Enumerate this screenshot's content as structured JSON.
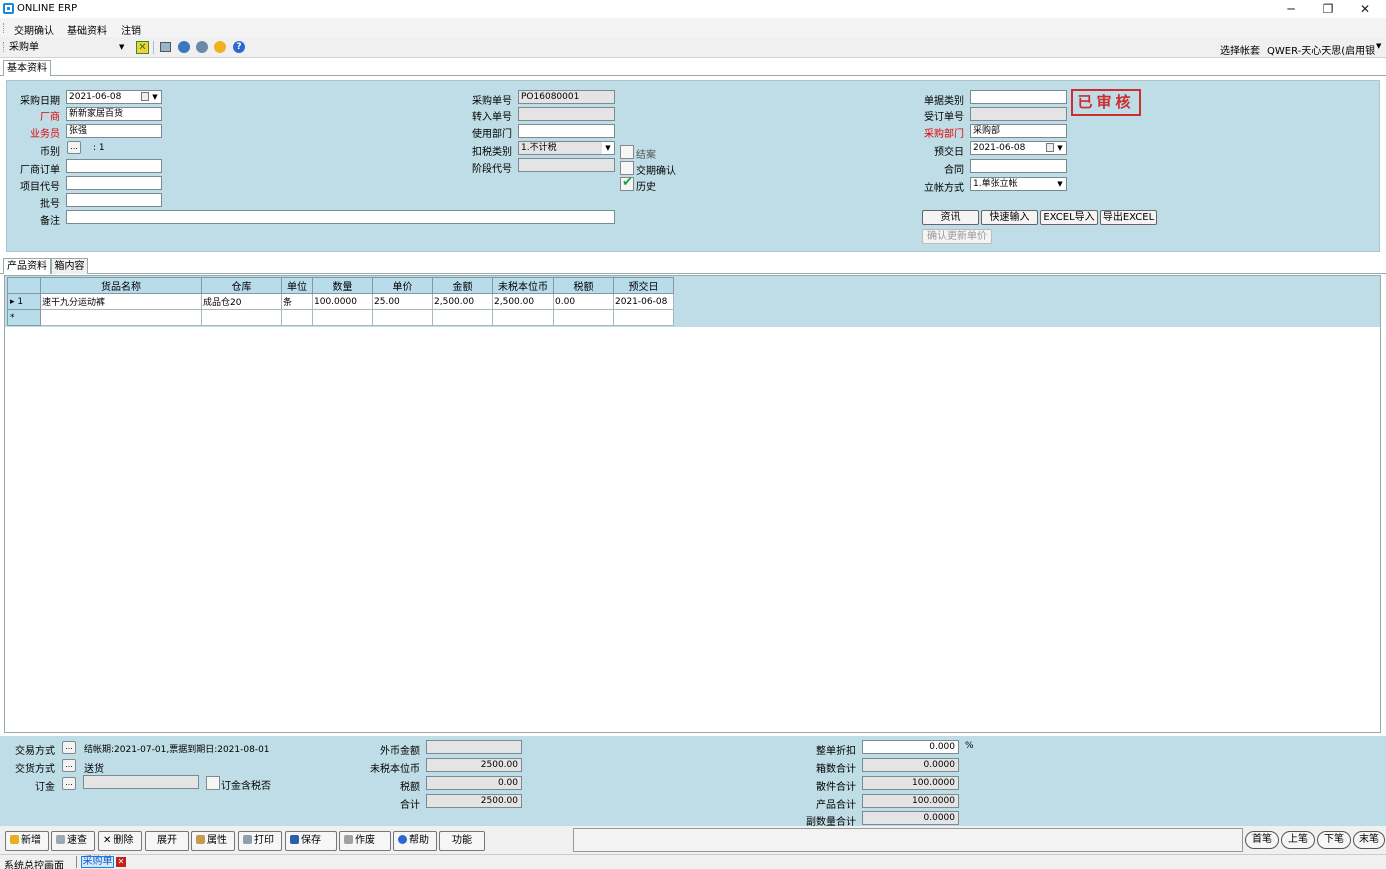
{
  "window": {
    "title": "ONLINE ERP",
    "minimize": "─",
    "restore": "❐",
    "close": "✕"
  },
  "menu": [
    "交期确认",
    "基础资料",
    "注销"
  ],
  "toolbar": {
    "form_select": "采购单",
    "account_label": "选择帐套",
    "account_value": "QWER-天心天思(启用银"
  },
  "main_tab": "基本资料",
  "header": {
    "purchase_date": {
      "label": "采购日期",
      "value": "2021-06-08"
    },
    "vendor": {
      "label": "厂商",
      "value": "新新家居百货"
    },
    "salesperson": {
      "label": "业务员",
      "value": "张强"
    },
    "currency": {
      "label": "币别",
      "btn": "...",
      "rate": ": 1"
    },
    "vendor_order": {
      "label": "厂商订单",
      "value": ""
    },
    "project_code": {
      "label": "项目代号",
      "value": ""
    },
    "batch_no": {
      "label": "批号",
      "value": ""
    },
    "remark": {
      "label": "备注",
      "value": ""
    },
    "purchase_no": {
      "label": "采购单号",
      "value": "PO16080001"
    },
    "import_no": {
      "label": "转入单号",
      "value": ""
    },
    "use_dept": {
      "label": "使用部门",
      "value": ""
    },
    "tax_type": {
      "label": "扣税类别",
      "value": "1.不计税"
    },
    "stage_code": {
      "label": "阶段代号",
      "value": ""
    },
    "chk_closed": {
      "label": "结案",
      "checked": false
    },
    "chk_delivery": {
      "label": "交期确认",
      "checked": false
    },
    "chk_history": {
      "label": "历史",
      "checked": true
    },
    "doc_category": {
      "label": "单据类别",
      "value": ""
    },
    "order_no": {
      "label": "受订单号",
      "value": ""
    },
    "purchase_dept": {
      "label": "采购部门",
      "value": "采购部"
    },
    "delivery_date": {
      "label": "预交日",
      "value": "2021-06-08"
    },
    "contract": {
      "label": "合同",
      "value": ""
    },
    "account_method": {
      "label": "立帐方式",
      "value": "1.单张立帐"
    },
    "stamp": "已审核",
    "buttons": {
      "info": "资讯",
      "quick_input": "快速输入",
      "excel_import": "EXCEL导入",
      "excel_export": "导出EXCEL",
      "confirm_price": "确认更新单价"
    }
  },
  "sub_tabs": [
    "产品资料",
    "箱内容"
  ],
  "grid": {
    "columns": [
      "货品名称",
      "仓库",
      "单位",
      "数量",
      "单价",
      "金额",
      "未税本位币",
      "税额",
      "预交日"
    ],
    "rows": [
      {
        "marker": "▸ 1",
        "cells": [
          "速干九分运动裤",
          "成品仓20",
          "条",
          "100.0000",
          "25.00",
          "2,500.00",
          "2,500.00",
          "0.00",
          "2021-06-08"
        ]
      }
    ],
    "new_row_marker": "*"
  },
  "footer": {
    "trade_mode": {
      "label": "交易方式",
      "btn": "...",
      "value": "结帐期:2021-07-01,票据到期日:2021-08-01"
    },
    "delivery_mode": {
      "label": "交货方式",
      "btn": "...",
      "value": "送货"
    },
    "deposit": {
      "label": "订金",
      "btn": "...",
      "value": "",
      "chk_label": "订金含税否"
    },
    "foreign_amount": {
      "label": "外币金额",
      "value": ""
    },
    "untaxed_local": {
      "label": "未税本位币",
      "value": "2500.00"
    },
    "tax": {
      "label": "税额",
      "value": "0.00"
    },
    "total": {
      "label": "合计",
      "value": "2500.00"
    },
    "discount": {
      "label": "整单折扣",
      "value": "0.000",
      "unit": "%"
    },
    "box_total": {
      "label": "箱数合计",
      "value": "0.0000"
    },
    "piece_total": {
      "label": "散件合计",
      "value": "100.0000"
    },
    "product_total": {
      "label": "产品合计",
      "value": "100.0000"
    },
    "sub_qty_total": {
      "label": "副数量合计",
      "value": "0.0000"
    }
  },
  "actions": [
    "新增",
    "速查",
    "删除",
    "展开",
    "属性",
    "打印",
    "保存",
    "作废",
    "帮助",
    "功能"
  ],
  "nav": [
    "首笔",
    "上笔",
    "下笔",
    "末笔"
  ],
  "taskbar": {
    "label": "系统总控画面",
    "active_tab": "采购单",
    "close": "✕"
  }
}
